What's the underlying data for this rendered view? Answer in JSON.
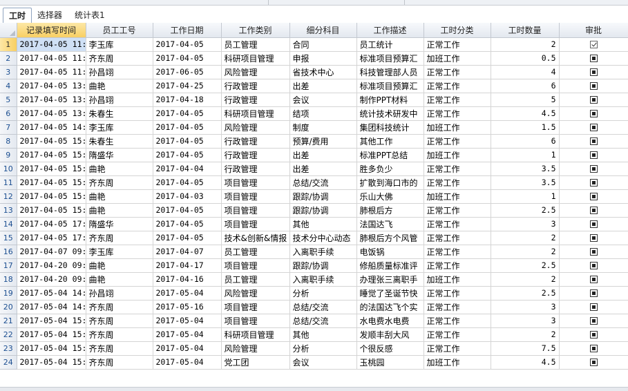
{
  "tabs": [
    {
      "label": "工时",
      "active": true
    },
    {
      "label": "选择器",
      "active": false
    },
    {
      "label": "统计表1",
      "active": false
    }
  ],
  "columns": [
    "记录填写时间",
    "员工工号",
    "工作日期",
    "工作类别",
    "细分科目",
    "工作描述",
    "工时分类",
    "工时数量",
    "审批"
  ],
  "rows": [
    {
      "num": "1",
      "time": "2017-04-05 11:",
      "emp": "李玉库",
      "date": "2017-04-05",
      "cat": "员工管理",
      "sub": "合同",
      "desc": "员工统计",
      "type": "正常工作",
      "hours": "2",
      "check": "checked"
    },
    {
      "num": "2",
      "time": "2017-04-05 11:",
      "emp": "齐东周",
      "date": "2017-04-05",
      "cat": "科研项目管理",
      "sub": "申报",
      "desc": "标准项目预算汇",
      "type": "加班工作",
      "hours": "0.5",
      "check": "filled"
    },
    {
      "num": "3",
      "time": "2017-04-05 11:",
      "emp": "孙昌翊",
      "date": "2017-06-05",
      "cat": "风险管理",
      "sub": "省技术中心",
      "desc": "科技管理部人员",
      "type": "正常工作",
      "hours": "4",
      "check": "filled"
    },
    {
      "num": "4",
      "time": "2017-04-05 13:",
      "emp": "曲艳",
      "date": "2017-04-25",
      "cat": "行政管理",
      "sub": "出差",
      "desc": "标准项目预算汇",
      "type": "正常工作",
      "hours": "6",
      "check": "filled"
    },
    {
      "num": "5",
      "time": "2017-04-05 13:",
      "emp": "孙昌翊",
      "date": "2017-04-18",
      "cat": "行政管理",
      "sub": "会议",
      "desc": "制作PPT材料",
      "type": "正常工作",
      "hours": "5",
      "check": "filled"
    },
    {
      "num": "6",
      "time": "2017-04-05 13:",
      "emp": "朱春生",
      "date": "2017-04-05",
      "cat": "科研项目管理",
      "sub": "结项",
      "desc": "统计技术研发中",
      "type": "正常工作",
      "hours": "4.5",
      "check": "filled"
    },
    {
      "num": "7",
      "time": "2017-04-05 14:",
      "emp": "李玉库",
      "date": "2017-04-05",
      "cat": "风险管理",
      "sub": "制度",
      "desc": "集团科技统计",
      "type": "加班工作",
      "hours": "1.5",
      "check": "filled"
    },
    {
      "num": "8",
      "time": "2017-04-05 15:",
      "emp": "朱春生",
      "date": "2017-04-05",
      "cat": "行政管理",
      "sub": "预算/费用",
      "desc": "其他工作",
      "type": "正常工作",
      "hours": "6",
      "check": "filled"
    },
    {
      "num": "9",
      "time": "2017-04-05 15:",
      "emp": "隋盛华",
      "date": "2017-04-05",
      "cat": "行政管理",
      "sub": "出差",
      "desc": "标准PPT总结",
      "type": "加班工作",
      "hours": "1",
      "check": "filled"
    },
    {
      "num": "10",
      "time": "2017-04-05 15:",
      "emp": "曲艳",
      "date": "2017-04-04",
      "cat": "行政管理",
      "sub": "出差",
      "desc": "胜多负少",
      "type": "正常工作",
      "hours": "3.5",
      "check": "filled"
    },
    {
      "num": "11",
      "time": "2017-04-05 15:",
      "emp": "齐东周",
      "date": "2017-04-05",
      "cat": "项目管理",
      "sub": "总结/交流",
      "desc": "扩散到海口市的",
      "type": "正常工作",
      "hours": "3.5",
      "check": "filled"
    },
    {
      "num": "12",
      "time": "2017-04-05 15:",
      "emp": "曲艳",
      "date": "2017-04-03",
      "cat": "项目管理",
      "sub": "跟踪/协调",
      "desc": "乐山大佛",
      "type": "加班工作",
      "hours": "1",
      "check": "filled"
    },
    {
      "num": "13",
      "time": "2017-04-05 15:",
      "emp": "曲艳",
      "date": "2017-04-05",
      "cat": "项目管理",
      "sub": "跟踪/协调",
      "desc": "肺根后方",
      "type": "正常工作",
      "hours": "2.5",
      "check": "filled"
    },
    {
      "num": "14",
      "time": "2017-04-05 17:",
      "emp": "隋盛华",
      "date": "2017-04-05",
      "cat": "项目管理",
      "sub": "其他",
      "desc": "法国达飞",
      "type": "正常工作",
      "hours": "3",
      "check": "filled"
    },
    {
      "num": "15",
      "time": "2017-04-05 17:",
      "emp": "齐东周",
      "date": "2017-04-05",
      "cat": "技术&创新&情报",
      "sub": "技术分中心动态",
      "desc": "肺根后方个风管",
      "type": "正常工作",
      "hours": "2",
      "check": "filled"
    },
    {
      "num": "16",
      "time": "2017-04-07 09:",
      "emp": "李玉库",
      "date": "2017-04-07",
      "cat": "员工管理",
      "sub": "入离职手续",
      "desc": "电饭锅",
      "type": "正常工作",
      "hours": "2",
      "check": "filled"
    },
    {
      "num": "17",
      "time": "2017-04-20 09:",
      "emp": "曲艳",
      "date": "2017-04-17",
      "cat": "项目管理",
      "sub": "跟踪/协调",
      "desc": "修船质量标准评",
      "type": "正常工作",
      "hours": "2.5",
      "check": "filled"
    },
    {
      "num": "18",
      "time": "2017-04-20 09:",
      "emp": "曲艳",
      "date": "2017-04-16",
      "cat": "员工管理",
      "sub": "入离职手续",
      "desc": "办理张三离职手",
      "type": "加班工作",
      "hours": "2",
      "check": "filled"
    },
    {
      "num": "19",
      "time": "2017-05-04 14:",
      "emp": "孙昌翊",
      "date": "2017-05-04",
      "cat": "风险管理",
      "sub": "分析",
      "desc": "睡觉了圣诞节快",
      "type": "正常工作",
      "hours": "2.5",
      "check": "filled"
    },
    {
      "num": "20",
      "time": "2017-05-04 14:",
      "emp": "齐东周",
      "date": "2017-05-16",
      "cat": "项目管理",
      "sub": "总结/交流",
      "desc": "的法国达飞个实",
      "type": "正常工作",
      "hours": "3",
      "check": "filled"
    },
    {
      "num": "21",
      "time": "2017-05-04 15:",
      "emp": "齐东周",
      "date": "2017-05-04",
      "cat": "项目管理",
      "sub": "总结/交流",
      "desc": "水电费水电费",
      "type": "正常工作",
      "hours": "3",
      "check": "filled"
    },
    {
      "num": "22",
      "time": "2017-05-04 15:",
      "emp": "齐东周",
      "date": "2017-05-04",
      "cat": "科研项目管理",
      "sub": "其他",
      "desc": "发顺丰刮大风",
      "type": "正常工作",
      "hours": "2",
      "check": "filled"
    },
    {
      "num": "23",
      "time": "2017-05-04 15:",
      "emp": "齐东周",
      "date": "2017-05-04",
      "cat": "风险管理",
      "sub": "分析",
      "desc": "个很反感",
      "type": "正常工作",
      "hours": "7.5",
      "check": "filled"
    },
    {
      "num": "24",
      "time": "2017-05-04 15:",
      "emp": "齐东周",
      "date": "2017-05-04",
      "cat": "党工团",
      "sub": "会议",
      "desc": "玉桃园",
      "type": "加班工作",
      "hours": "4.5",
      "check": "filled"
    }
  ],
  "colors": {
    "selected_header": "#f8cf63",
    "row_number_text": "#1d4f91",
    "grid_line": "#d4d4d4"
  }
}
